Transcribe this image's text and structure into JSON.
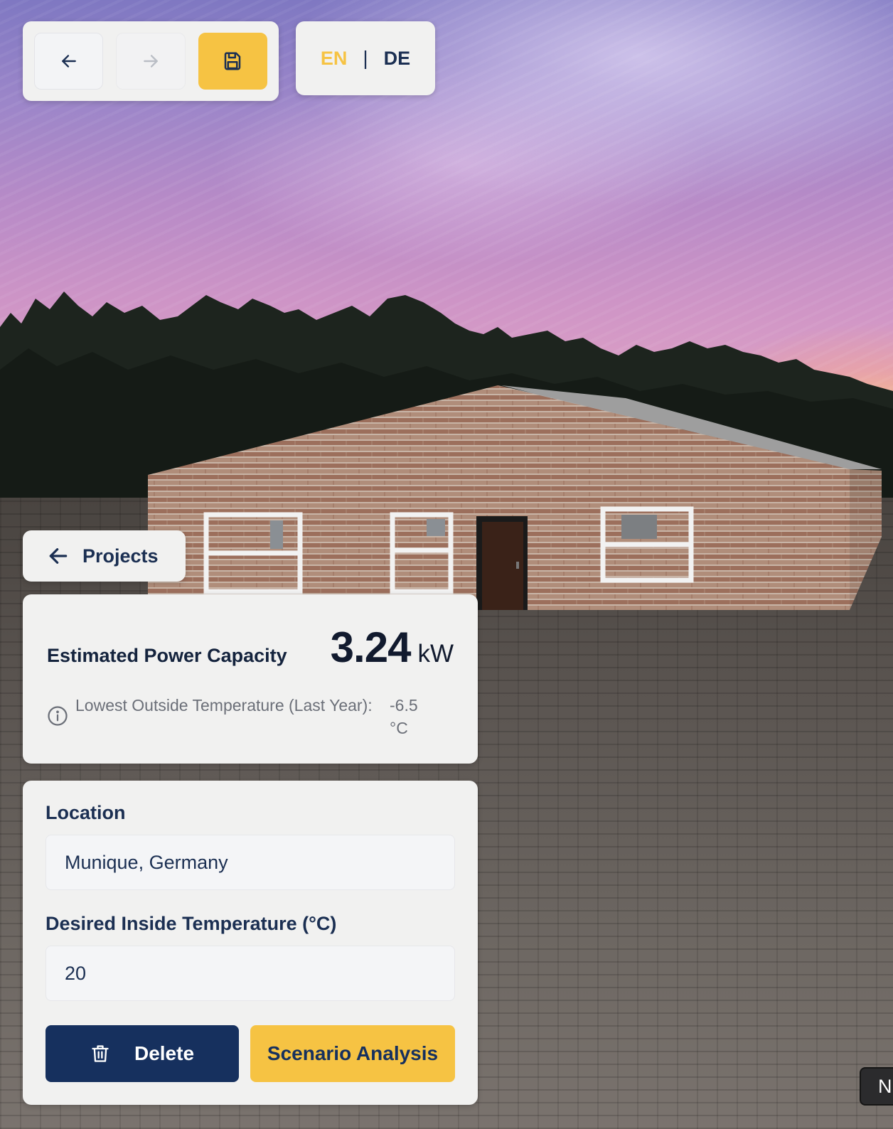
{
  "toolbar": {
    "undo_icon": "arrow-left-icon",
    "redo_icon": "arrow-right-icon",
    "save_icon": "floppy-disk-icon"
  },
  "language": {
    "en": "EN",
    "separator": "|",
    "de": "DE",
    "active": "EN"
  },
  "nav": {
    "projects_label": "Projects"
  },
  "power": {
    "title": "Estimated Power Capacity",
    "value": "3.24",
    "unit": "kW",
    "lowest_temp_label": "Lowest Outside Temperature (Last Year):",
    "lowest_temp_value": "-6.5 °C"
  },
  "form": {
    "location_label": "Location",
    "location_value": "Munique, Germany",
    "temperature_label": "Desired Inside Temperature (°C)",
    "temperature_value": "20"
  },
  "actions": {
    "delete_label": "Delete",
    "scenario_label": "Scenario Analysis"
  },
  "corner": {
    "label": "N"
  },
  "colors": {
    "accent": "#f6c343",
    "primary": "#16305e",
    "panel": "#f1f1f0"
  }
}
